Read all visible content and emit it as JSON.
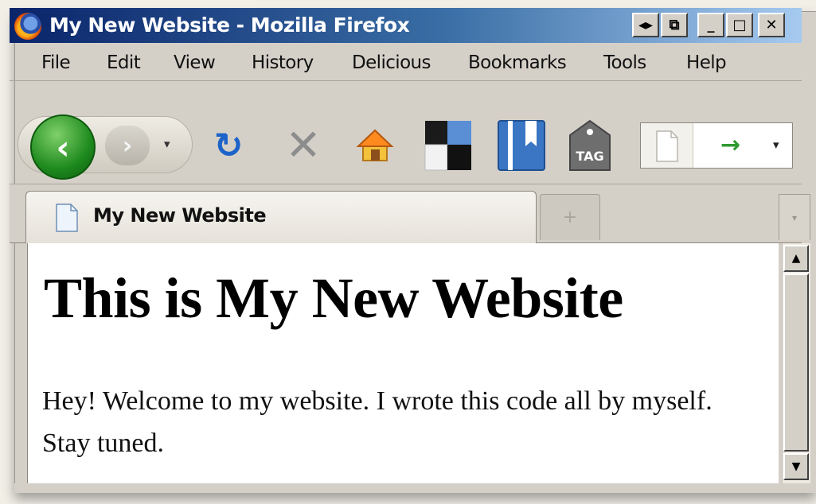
{
  "window": {
    "title": "My New Website - Mozilla Firefox",
    "controls": {
      "maximize_small": "◂▸",
      "restore_small": "⧉",
      "minimize": "_",
      "maximize": "□",
      "close": "✕"
    }
  },
  "menu": {
    "items": [
      "File",
      "Edit",
      "View",
      "History",
      "Delicious",
      "Bookmarks",
      "Tools",
      "Help"
    ]
  },
  "toolbar": {
    "back_icon": "‹",
    "forward_icon": "›",
    "dropdown": "▾",
    "reload_icon": "↻",
    "stop_icon": "✕",
    "go_icon": "→",
    "tag_label": "TAG"
  },
  "tabs": {
    "active_label": "My New Website",
    "new_tab_icon": "+",
    "list_icon": "▾"
  },
  "page": {
    "heading": "This is My New Website",
    "paragraph": "Hey! Welcome to my website. I wrote this code all by myself. Stay tuned."
  },
  "scrollbar": {
    "up": "▲",
    "down": "▼"
  },
  "colors": {
    "titlebar_start": "#0a246a",
    "titlebar_end": "#a6caf0",
    "chrome": "#d4d0c8",
    "back_green": "#1e8a1e",
    "reload_blue": "#1d63c9"
  },
  "icons": [
    "firefox-logo",
    "back-arrow",
    "forward-arrow",
    "reload-icon",
    "stop-icon",
    "home-icon",
    "delicious-icon",
    "bookmark-icon",
    "tag-icon",
    "page-icon",
    "go-arrow-icon"
  ]
}
